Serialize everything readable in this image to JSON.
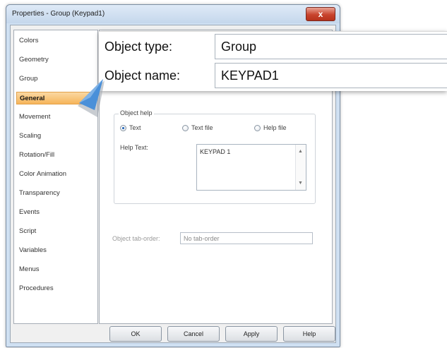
{
  "window": {
    "title": "Properties - Group (Keypad1)",
    "close_glyph": "x",
    "close_icon": "close-icon"
  },
  "nav": {
    "items": [
      {
        "label": "Colors",
        "selected": false
      },
      {
        "label": "Geometry",
        "selected": false
      },
      {
        "label": "Group",
        "selected": false
      },
      {
        "label": "General",
        "selected": true
      },
      {
        "label": "Movement",
        "selected": false
      },
      {
        "label": "Scaling",
        "selected": false
      },
      {
        "label": "Rotation/Fill",
        "selected": false
      },
      {
        "label": "Color Animation",
        "selected": false
      },
      {
        "label": "Transparency",
        "selected": false
      },
      {
        "label": "Events",
        "selected": false
      },
      {
        "label": "Script",
        "selected": false
      },
      {
        "label": "Variables",
        "selected": false
      },
      {
        "label": "Menus",
        "selected": false
      },
      {
        "label": "Procedures",
        "selected": false
      }
    ]
  },
  "callout": {
    "object_type_label": "Object type:",
    "object_type_value": "Group",
    "object_name_label": "Object name:",
    "object_name_value": "KEYPAD1"
  },
  "object_help": {
    "title": "Object help",
    "radio_text": "Text",
    "radio_text_file": "Text file",
    "radio_help_file": "Help file",
    "selected": "Text",
    "help_text_label": "Help Text:",
    "help_text_value": "KEYPAD 1"
  },
  "tab_order": {
    "label": "Object tab-order:",
    "value": "No tab-order"
  },
  "buttons": {
    "ok": "OK",
    "cancel": "Cancel",
    "apply": "Apply",
    "help": "Help"
  },
  "colors": {
    "selected_nav_bg": "#f6b55a",
    "pointer_arrow": "#4a90d9",
    "close_button": "#c8432d"
  }
}
